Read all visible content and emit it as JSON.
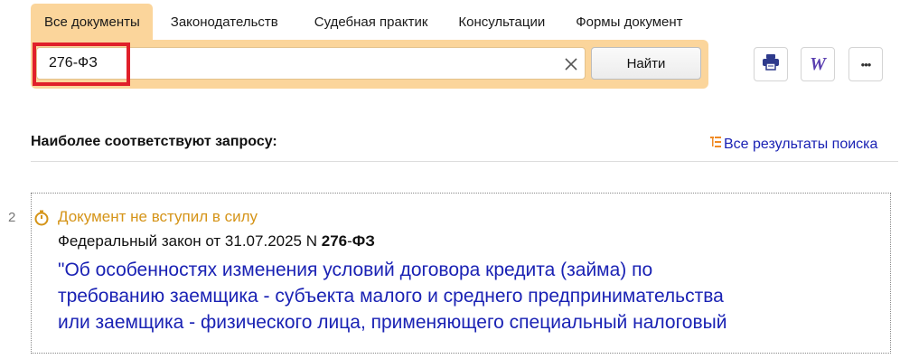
{
  "tabs": [
    {
      "label": "Все документы",
      "active": true
    },
    {
      "label": "Законодательств"
    },
    {
      "label": "Судебная практик"
    },
    {
      "label": "Консультации"
    },
    {
      "label": "Формы документ"
    }
  ],
  "search": {
    "value": "276-ФЗ",
    "button_label": "Найти",
    "clear_icon": "close-icon"
  },
  "toolbar": {
    "print_icon": "print-icon",
    "word_icon": "word-export-icon",
    "word_glyph": "W",
    "more_icon": "more-icon",
    "more_glyph": "•••"
  },
  "results": {
    "heading": "Наиболее соответствуют запросу:",
    "all_results_label": "Все результаты поиска",
    "items": [
      {
        "number": "2",
        "status": "Документ не вступил в силу",
        "meta_prefix": "Федеральный закон от 31.07.2025 N ",
        "meta_number": "276",
        "meta_dash": "-",
        "meta_suffix": "ФЗ",
        "title_lines": [
          "\"Об особенностях изменения условий договора кредита (займа) по",
          "требованию заемщика - субъекта малого и среднего предпринимательства",
          "или заемщика - физического лица, применяющего специальный налоговый"
        ]
      }
    ]
  },
  "colors": {
    "tab_active": "#fbd59b",
    "link": "#1a22b4",
    "status": "#d59418",
    "highlight": "#e0202a"
  }
}
